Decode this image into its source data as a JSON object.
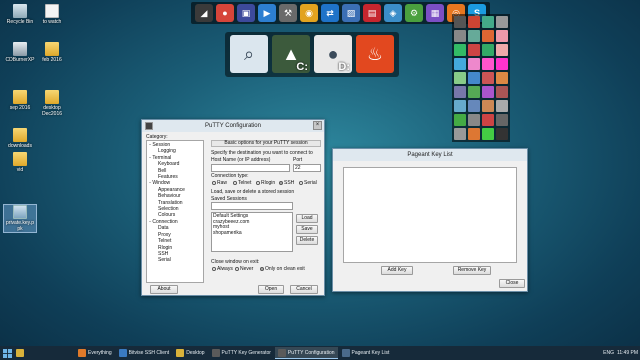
{
  "desktop_icons": [
    {
      "name": "recycle-bin",
      "label": "Recycle Bin",
      "glyph": "bin"
    },
    {
      "name": "to-watch",
      "label": "to watch",
      "glyph": "file"
    },
    {
      "name": "cdburnerxp",
      "label": "CDBurnerXP",
      "glyph": "burner"
    },
    {
      "name": "feb-2016",
      "label": "feb 2016",
      "glyph": "folder"
    },
    {
      "name": "sep-2016",
      "label": "sep 2016",
      "glyph": "folder"
    },
    {
      "name": "desktop-dec2016",
      "label": "desktop Dec2016",
      "glyph": "folder"
    },
    {
      "name": "downloads",
      "label": "downloads",
      "glyph": "folder"
    },
    {
      "name": "vid",
      "label": "vid",
      "glyph": "folder"
    },
    {
      "name": "private-key-ppk",
      "label": "private.key.p pk",
      "glyph": "ppk"
    }
  ],
  "launcher_top": [
    {
      "name": "tool-icon",
      "color": "#3a3a3a",
      "glyph": "◢"
    },
    {
      "name": "chrome-icon",
      "color": "#d6453a",
      "glyph": "●"
    },
    {
      "name": "pixel-app-icon",
      "color": "#3d4a9c",
      "glyph": "▣"
    },
    {
      "name": "media-app-icon",
      "color": "#2d7fd1",
      "glyph": "▶"
    },
    {
      "name": "wrench-app-icon",
      "color": "#6a6a6a",
      "glyph": "⚒"
    },
    {
      "name": "ftp-app-icon",
      "color": "#e2a31f",
      "glyph": "◉"
    },
    {
      "name": "teamviewer-icon",
      "color": "#1f73c8",
      "glyph": "⇄"
    },
    {
      "name": "photo-app-icon",
      "color": "#3b6fb5",
      "glyph": "▨"
    },
    {
      "name": "pdf-app-icon",
      "color": "#c6262e",
      "glyph": "▤"
    },
    {
      "name": "blue-app-icon",
      "color": "#3b8ec9",
      "glyph": "◈"
    },
    {
      "name": "gear-app-icon",
      "color": "#4aa03e",
      "glyph": "⚙"
    },
    {
      "name": "pixel-editor-icon",
      "color": "#7b4fc4",
      "glyph": "▦"
    },
    {
      "name": "firefox-icon",
      "color": "#e8761f",
      "glyph": "◎"
    },
    {
      "name": "skype-icon",
      "color": "#1b9be0",
      "glyph": "S"
    }
  ],
  "launcher_big": [
    {
      "name": "search-doc-icon",
      "color": "#dbe6ee",
      "glyph": "⌕",
      "drive": ""
    },
    {
      "name": "drive-c-icon",
      "color": "#3c5a3c",
      "glyph": "▲",
      "drive": "C:"
    },
    {
      "name": "drive-d-icon",
      "color": "#e8e8e8",
      "glyph": "●",
      "drive": "D:"
    },
    {
      "name": "codeigniter-icon",
      "color": "#e2481f",
      "glyph": "♨",
      "drive": ""
    }
  ],
  "grid_colors": [
    "#555",
    "#c43",
    "#4a8",
    "#999",
    "#888",
    "#6a9",
    "#d63",
    "#e9a",
    "#3b6",
    "#c44",
    "#3a6",
    "#eaa",
    "#4ad",
    "#e8c",
    "#f5c",
    "#f3c",
    "#8c8",
    "#48c",
    "#c55",
    "#d84",
    "#77a",
    "#5a5",
    "#a5c",
    "#a55",
    "#6ac",
    "#68b",
    "#c85",
    "#aaa",
    "#4a4",
    "#888",
    "#c44",
    "#666",
    "#999",
    "#d73",
    "#4c4",
    "#333"
  ],
  "putty": {
    "title": "PuTTY Configuration",
    "category_label": "Category:",
    "tree": [
      {
        "label": "Session",
        "level": 1,
        "expanded": true
      },
      {
        "label": "Logging",
        "level": 2
      },
      {
        "label": "Terminal",
        "level": 1,
        "expanded": true
      },
      {
        "label": "Keyboard",
        "level": 2
      },
      {
        "label": "Bell",
        "level": 2
      },
      {
        "label": "Features",
        "level": 2
      },
      {
        "label": "Window",
        "level": 1,
        "expanded": true
      },
      {
        "label": "Appearance",
        "level": 2
      },
      {
        "label": "Behaviour",
        "level": 2
      },
      {
        "label": "Translation",
        "level": 2
      },
      {
        "label": "Selection",
        "level": 2
      },
      {
        "label": "Colours",
        "level": 2
      },
      {
        "label": "Connection",
        "level": 1,
        "expanded": true
      },
      {
        "label": "Data",
        "level": 2
      },
      {
        "label": "Proxy",
        "level": 2
      },
      {
        "label": "Telnet",
        "level": 2
      },
      {
        "label": "Rlogin",
        "level": 2
      },
      {
        "label": "SSH",
        "level": 2
      },
      {
        "label": "Serial",
        "level": 2
      }
    ],
    "group_title": "Basic options for your PuTTY session",
    "dest_label": "Specify the destination you want to connect to",
    "host_label": "Host Name (or IP address)",
    "host_value": "",
    "port_label": "Port",
    "port_value": "22",
    "conn_type_label": "Connection type:",
    "conn_types": [
      {
        "label": "Raw",
        "selected": false
      },
      {
        "label": "Telnet",
        "selected": false
      },
      {
        "label": "Rlogin",
        "selected": false
      },
      {
        "label": "SSH",
        "selected": true
      },
      {
        "label": "Serial",
        "selected": false
      }
    ],
    "load_save_label": "Load, save or delete a stored session",
    "saved_sessions_label": "Saved Sessions",
    "saved_sessions_value": "",
    "sessions": [
      "Default Settings",
      "crazybeeez.com",
      "myhost",
      "shopamerika"
    ],
    "load_label": "Load",
    "save_label": "Save",
    "delete_label": "Delete",
    "close_exit_label": "Close window on exit:",
    "close_options": [
      {
        "label": "Always",
        "selected": false
      },
      {
        "label": "Never",
        "selected": false
      },
      {
        "label": "Only on clean exit",
        "selected": true
      }
    ],
    "about_label": "About",
    "open_label": "Open",
    "cancel_label": "Cancel"
  },
  "pageant": {
    "title": "Pageant Key List",
    "add_key_label": "Add Key",
    "remove_key_label": "Remove Key",
    "close_label": "Close"
  },
  "taskbar": {
    "items": [
      {
        "label": "Everything",
        "color": "#e07a2a",
        "active": false
      },
      {
        "label": "Bitvise SSH Client",
        "color": "#3a7ac0",
        "active": false
      },
      {
        "label": "Desktop",
        "color": "#d9b23a",
        "active": false
      },
      {
        "label": "PuTTY Key Generator",
        "color": "#5a5a5a",
        "active": false
      },
      {
        "label": "PuTTY Configuration",
        "color": "#5a5a5a",
        "active": true
      },
      {
        "label": "Pageant Key List",
        "color": "#4a6a8a",
        "active": false
      }
    ],
    "lang": "ENG",
    "time": "11:49 PM"
  }
}
